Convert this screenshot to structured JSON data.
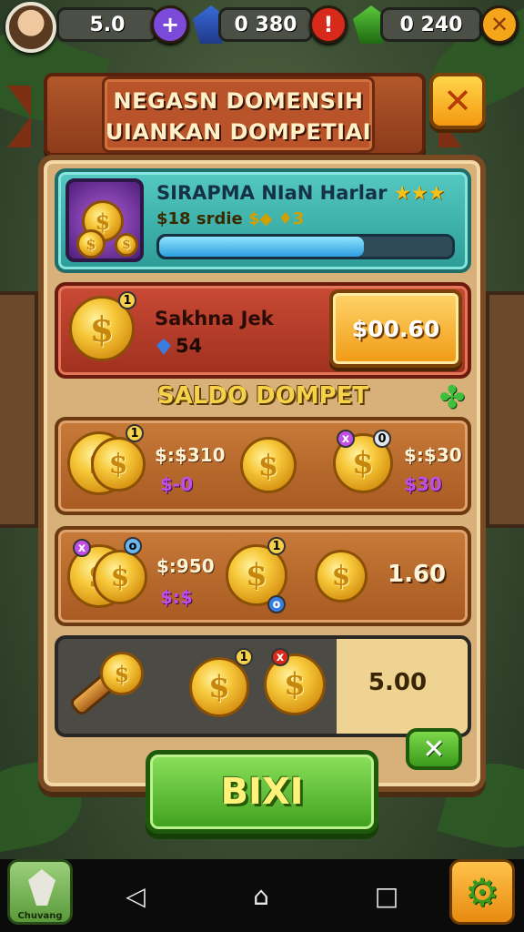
{
  "hud": {
    "coins_value": "5.0",
    "gems_value": "0  380",
    "leaf_value": "0  240",
    "plus_label": "+",
    "alert_label": "!",
    "close_label": "✕"
  },
  "banner": {
    "line1": "NEGASN DOMENSIH",
    "line2": "UIANKAN DOMPETIAI",
    "close_label": "✕"
  },
  "quest": {
    "title": "SIRAPMA NIaN Harlar",
    "stars": "★★★",
    "sub_amount": "$18",
    "sub_label": "srdie",
    "sub_symbols": "$◆",
    "sub_end": "♦3",
    "progress_fraction": 0.7,
    "progress_color": "#2f9fe0"
  },
  "reward": {
    "name": "Sakhna Jek",
    "count": "54",
    "price": "$00.60"
  },
  "wallet": {
    "title": "SALDO DOMPET",
    "clover_icon": "✤",
    "row1": {
      "value_a": "$:$310",
      "purple_a": "$-0",
      "value_b": "$:$30",
      "purple_b": "$30"
    },
    "row2": {
      "value_a": "$:950",
      "purple_a": "$:$",
      "value_b": "1.60"
    },
    "row3": {
      "value": "5.00"
    }
  },
  "buttons": {
    "small_label": "✕",
    "main_label": "BIXI"
  },
  "navbar": {
    "left_label": "Chuvang",
    "back_icon": "◁",
    "home_icon": "⌂",
    "recent_icon": "□",
    "settings_icon": "⚙"
  },
  "colors": {
    "panel": "#d8b07a",
    "banner": "#b2582b",
    "quest": "#54c9c2",
    "reward": "#c94a35",
    "wallet_row": "#c77a38",
    "primary_button": "#3fa01e"
  }
}
